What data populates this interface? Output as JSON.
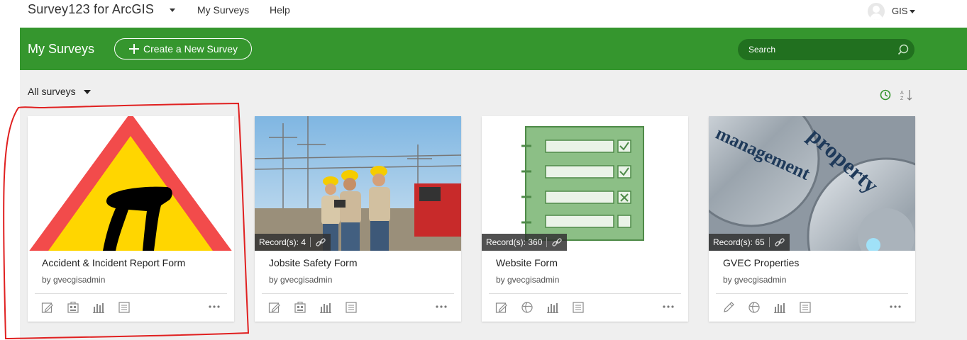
{
  "topnav": {
    "app_title": "Survey123 for ArcGIS",
    "links": [
      "My Surveys",
      "Help"
    ],
    "user": "GIS"
  },
  "header": {
    "title": "My Surveys",
    "create_label": "Create a New Survey",
    "search_placeholder": "Search",
    "bg_color": "#35962e",
    "search_bg": "#21701f"
  },
  "toolbar": {
    "filter_label": "All surveys"
  },
  "cards": [
    {
      "title": "Accident & Incident Report Form",
      "owner": "by gvecgisadmin",
      "records": "",
      "thumb": "warning-sign"
    },
    {
      "title": "Jobsite Safety Form",
      "owner": "by gvecgisadmin",
      "records": "Record(s): 4",
      "thumb": "workers-photo"
    },
    {
      "title": "Website Form",
      "owner": "by gvecgisadmin",
      "records": "Record(s): 360",
      "thumb": "checklist"
    },
    {
      "title": "GVEC Properties",
      "owner": "by gvecgisadmin",
      "records": "Record(s): 65",
      "thumb": "gears-property-management"
    }
  ],
  "thumb_text": {
    "word1": "property",
    "word2": "management"
  },
  "colors": {
    "accent_green": "#35962e",
    "highlight_red": "#e02020"
  }
}
